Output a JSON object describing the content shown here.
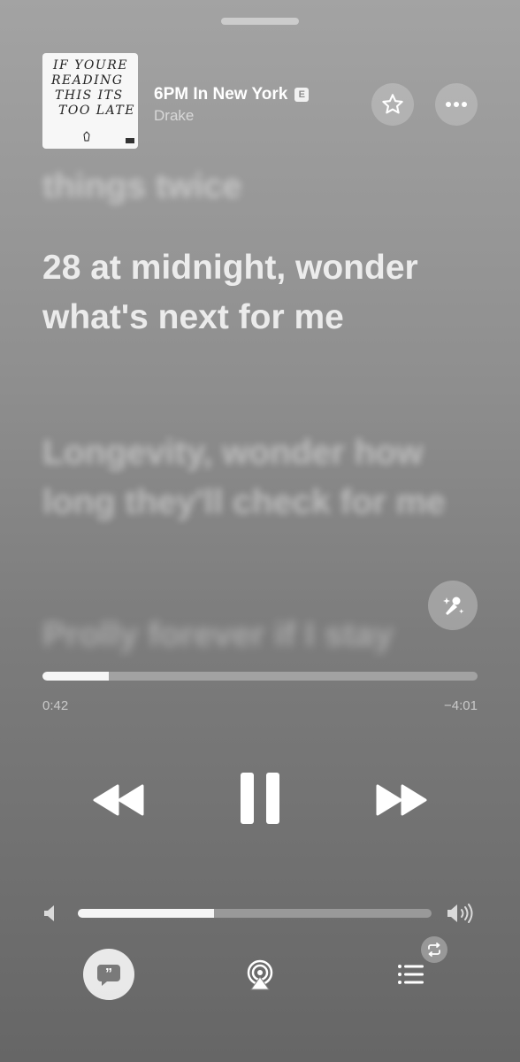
{
  "now_playing": {
    "title": "6PM In New York",
    "explicit_badge": "E",
    "artist": "Drake",
    "artwork": {
      "lines": [
        "IF YOURE",
        "READING",
        "THIS ITS",
        "TOO LATE"
      ]
    }
  },
  "lyrics": {
    "previous": "things twice",
    "current": "28 at midnight, wonder what's next for me",
    "next": "Longevity, wonder how long they'll check for me",
    "upcoming": "Prolly forever if I stay"
  },
  "playback": {
    "elapsed": "0:42",
    "remaining": "−4:01",
    "progress_fraction": 0.153,
    "state": "playing"
  },
  "volume": {
    "level_fraction": 0.385
  },
  "icons": {
    "star": "star-icon",
    "more": "ellipsis-icon",
    "karaoke": "microphone-sparkle-icon",
    "rewind": "rewind-icon",
    "pause": "pause-icon",
    "forward": "fast-forward-icon",
    "lyrics": "quote-bubble-icon",
    "airplay": "airplay-icon",
    "queue": "list-icon",
    "repeat": "repeat-icon"
  }
}
